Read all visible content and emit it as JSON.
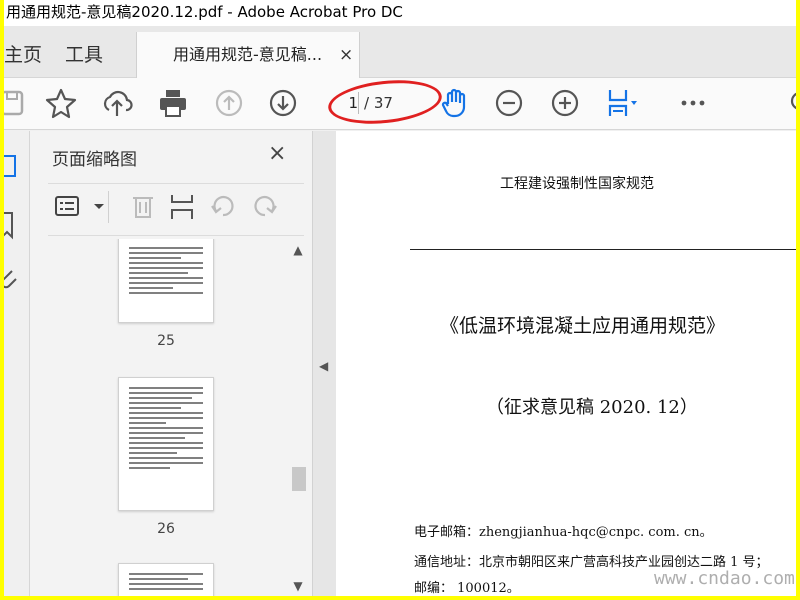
{
  "window": {
    "title": "用通用规范-意见稿2020.12.pdf - Adobe Acrobat Pro DC"
  },
  "tabs": {
    "home": "主页",
    "tools": "工具",
    "document": "用通用规范-意见稿...",
    "close": "×"
  },
  "toolbar": {
    "current_page": "1",
    "total_pages": "/ 37",
    "icons": [
      "save-icon",
      "star-icon",
      "upload-icon",
      "print-icon",
      "page-up-icon",
      "page-down-icon",
      "hand-icon",
      "zoom-out-icon",
      "zoom-in-icon",
      "fit-page-icon",
      "more-icon"
    ]
  },
  "thumbnails_panel": {
    "title": "页面缩略图",
    "close": "×",
    "pages": [
      {
        "number": "25"
      },
      {
        "number": "26"
      }
    ]
  },
  "document": {
    "header": "工程建设强制性国家规范",
    "title": "《低温环境混凝土应用通用规范》",
    "subtitle": "（征求意见稿 2020. 12）",
    "email_line": "电子邮箱：zhengjianhua-hqc@cnpc. com. cn。",
    "address_line": "通信地址：北京市朝阳区来广营高科技产业园创达二路 1 号；",
    "postcode_line": "邮编： 100012。"
  },
  "watermark": "www.cndao.com",
  "colors": {
    "accent_blue": "#1473e6",
    "annotation_red": "#e02020",
    "frame_yellow": "#ffff00"
  }
}
